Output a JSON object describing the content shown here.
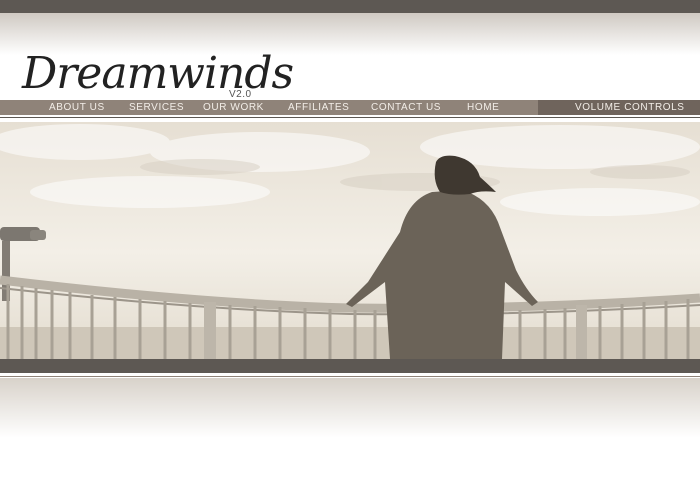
{
  "brand": {
    "name": "Dreamwinds",
    "version": "V2.0"
  },
  "nav": {
    "items": [
      {
        "label": "ABOUT US"
      },
      {
        "label": "SERVICES"
      },
      {
        "label": "OUR WORK"
      },
      {
        "label": "AFFILIATES"
      },
      {
        "label": "CONTACT US"
      },
      {
        "label": "HOME"
      }
    ],
    "volume_label": "VOLUME CONTROLS"
  },
  "colors": {
    "bar_dark": "#5d5853",
    "nav_bg": "#8f8379",
    "volume_bg": "#6f645c",
    "nav_text": "#f3eee8"
  },
  "hero": {
    "icon": "hero-photo-woman-on-balcony"
  }
}
